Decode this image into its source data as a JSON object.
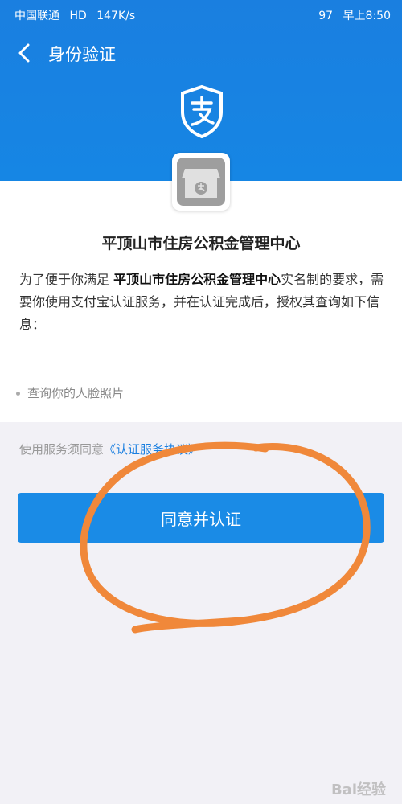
{
  "status_bar": {
    "carrier": "中国联通",
    "network": "HD",
    "speed": "147K/s",
    "battery": "97",
    "time": "早上8:50"
  },
  "nav": {
    "title": "身份验证"
  },
  "org_name": "平顶山市住房公积金管理中心",
  "description": {
    "prefix": "为了便于你满足",
    "org": "平顶山市住房公积金管理中心",
    "suffix": "实名制的要求，需要你使用支付宝认证服务，并在认证完成后，授权其查询如下信息："
  },
  "info_items": [
    "查询你的人脸照片"
  ],
  "agreement": {
    "prefix": "使用服务须同意",
    "link": "《认证服务协议》"
  },
  "confirm_button": "同意并认证",
  "watermark": "Bai经验",
  "colors": {
    "brand_blue": "#1a7fe0",
    "button_blue": "#1a8be6",
    "annotation_orange": "#f0883a"
  },
  "icons": [
    "back-arrow-icon",
    "alipay-shield-icon",
    "store-icon"
  ]
}
